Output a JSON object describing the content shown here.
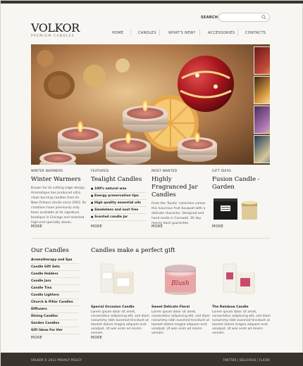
{
  "header": {
    "search_label": "SEARCH",
    "search_placeholder": "",
    "logo_name": "VOLKOR",
    "logo_tagline": "PREMIUM CANDLES"
  },
  "nav": [
    "HOME",
    "CANDLES",
    "WHAT'S NEW?",
    "ACCESSORIES",
    "CONTACTS"
  ],
  "features": [
    {
      "label": "WINTER WARMERS",
      "title": "Winter Warmers",
      "text": "Known for its cutting edge design, Aromatique has produced ultra clean burning candles from its New Orleans studio since 2003. Its creations have previously only been available at its signature boutique in Chicago and selected high-end specialty stores.",
      "more": "MORE"
    },
    {
      "label": "FEATURED",
      "title": "Tealight Candles",
      "items": [
        "100% natural wax",
        "Energy preservation tips",
        "High quality essential oils",
        "Smokeless and soot free",
        "Scented candle jar"
      ],
      "more": "MORE"
    },
    {
      "label": "MOST WANTED",
      "title": "Highly Fragranced Jar Candles",
      "text": "From the 'Rustic' collection comes this luxurious fruit bouquet with a delicate character. Designed and hand made in Cornwall. 30 day money back guarantee.",
      "more": "MORE"
    },
    {
      "label": "GIFT IDEAS",
      "title": "Fusion Candle - Garden",
      "more": "MORE"
    }
  ],
  "our_candles": {
    "title": "Our Candles",
    "items": [
      "Aromatherapy and Spa",
      "Candle Gift Sets",
      "Candle Holders",
      "Candle Jars",
      "Candle Tins",
      "Candle Lighters",
      "Church & Pillar Candles",
      "Diffusers",
      "Dining Candles",
      "Garden Candles",
      "Gift Ideas For Her"
    ],
    "more": "MORE"
  },
  "gifts": {
    "title": "Candles make a perfect gift",
    "products": [
      {
        "name": "Special Occasion Candle",
        "desc": "Lorem ipsum dolor sit amet, consectetur adipiscing elit, sed diam nonummy nibh euismod tincidunt ut laoreet dolore magna aliquam erat volutpat. Ut wisi enim ad minim veniam."
      },
      {
        "name": "Sweet Delicate Floral",
        "desc": "Lorem ipsum dolor sit amet, consectetur adipiscing elit, sed diam nonummy nibh euismod tincidunt ut laoreet dolore magna aliquam erat volutpat. Ut wisi enim ad minim veniam.",
        "tin_text": "Blush"
      },
      {
        "name": "The Rainbow Candle",
        "desc": "Lorem ipsum dolor sit amet, consectetur adipiscing elit, sed diam nonummy nibh euismod tincidunt ut laoreet dolore magna aliquam erat volutpat. Ut wisi enim ad minim veniam."
      }
    ],
    "more": "MORE"
  },
  "footer": {
    "left": "VOLKOR © 2011 PRIVACY POLICY",
    "right": "TWITTER | DELICIOUS | FLICKR"
  },
  "icons": {
    "search": "search-icon"
  },
  "colors": {
    "footer_bg": "#3a342e",
    "page_bg": "#f7f6f2",
    "accent_red": "#b8262b"
  }
}
